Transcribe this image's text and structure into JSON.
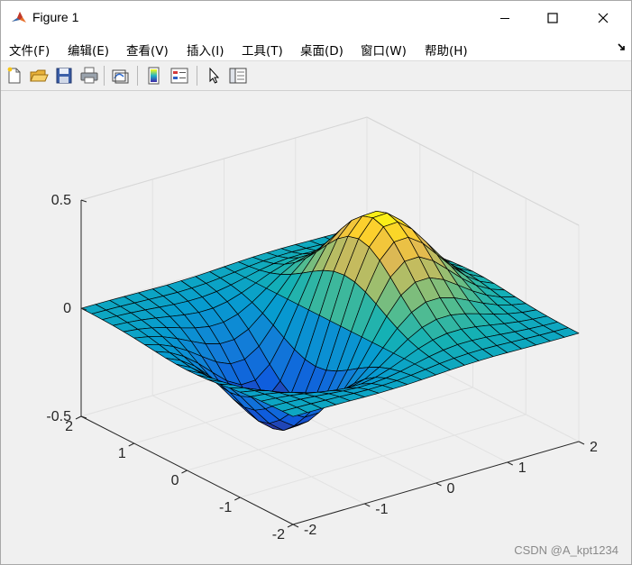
{
  "window": {
    "title": "Figure 1"
  },
  "menu": {
    "items": [
      {
        "label": "文件(F)",
        "id": "file"
      },
      {
        "label": "编辑(E)",
        "id": "edit"
      },
      {
        "label": "查看(V)",
        "id": "view"
      },
      {
        "label": "插入(I)",
        "id": "insert"
      },
      {
        "label": "工具(T)",
        "id": "tools"
      },
      {
        "label": "桌面(D)",
        "id": "desktop"
      },
      {
        "label": "窗口(W)",
        "id": "window"
      },
      {
        "label": "帮助(H)",
        "id": "help"
      }
    ]
  },
  "toolbar": {
    "buttons": [
      "new-figure-icon",
      "open-file-icon",
      "save-icon",
      "print-icon",
      "link-plot-icon",
      "colorbar-icon",
      "legend-icon",
      "pointer-icon",
      "property-editor-icon"
    ]
  },
  "chart_data": {
    "type": "surface",
    "function": "z = x*exp(-x^2 - y^2)",
    "x_range": [
      -2,
      2
    ],
    "y_range": [
      -2,
      2
    ],
    "grid_size": 20,
    "zlim": [
      -0.5,
      0.5
    ],
    "x_ticks": [
      "-2",
      "-1",
      "0",
      "1",
      "2"
    ],
    "y_ticks": [
      "-2",
      "-1",
      "0",
      "1",
      "2"
    ],
    "z_ticks": [
      "-0.5",
      "0",
      "0.5"
    ],
    "colormap": "parula",
    "title": "",
    "xlabel": "",
    "ylabel": "",
    "zlabel": ""
  },
  "watermark": "CSDN @A_kpt1234",
  "colors": {
    "titlebar_bg": "#ffffff",
    "window_bg": "#f0f0f0",
    "edge": "#000000"
  }
}
